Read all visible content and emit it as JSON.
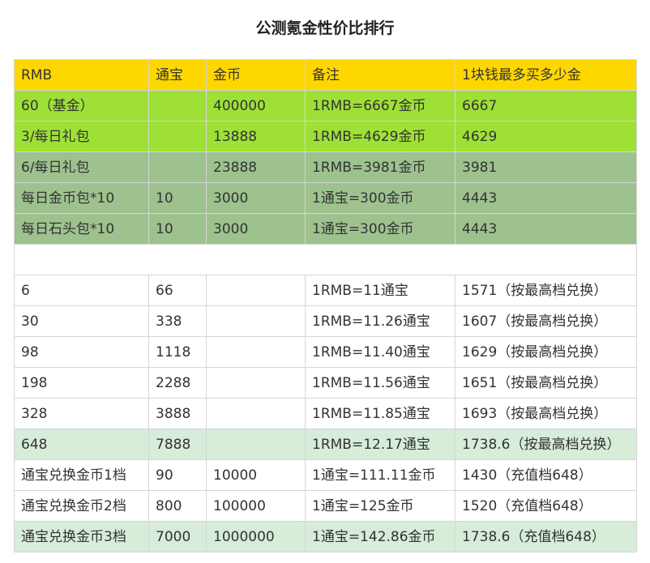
{
  "title": "公测氪金性价比排行",
  "table": {
    "headers": [
      "RMB",
      "通宝",
      "金币",
      "备注",
      "1块钱最多买多少金"
    ],
    "section1": [
      {
        "style": "bright",
        "cells": [
          "60（基金）",
          "",
          "400000",
          "1RMB=6667金币",
          "6667"
        ]
      },
      {
        "style": "bright",
        "cells": [
          "3/每日礼包",
          "",
          "13888",
          "1RMB=4629金币",
          "4629"
        ]
      },
      {
        "style": "sage",
        "cells": [
          "6/每日礼包",
          "",
          "23888",
          "1RMB=3981金币",
          "3981"
        ]
      },
      {
        "style": "sage",
        "cells": [
          "每日金币包*10",
          "10",
          "3000",
          "1通宝=300金币",
          "4443"
        ]
      },
      {
        "style": "sage",
        "cells": [
          "每日石头包*10",
          "10",
          "3000",
          "1通宝=300金币",
          "4443"
        ]
      }
    ],
    "section2": [
      {
        "style": "plain",
        "cells": [
          "6",
          "66",
          "",
          "1RMB=11通宝",
          "1571（按最高档兑换）"
        ]
      },
      {
        "style": "plain",
        "cells": [
          "30",
          "338",
          "",
          "1RMB=11.26通宝",
          "1607（按最高档兑换）"
        ]
      },
      {
        "style": "plain",
        "cells": [
          "98",
          "1118",
          "",
          "1RMB=11.40通宝",
          "1629（按最高档兑换）"
        ]
      },
      {
        "style": "plain",
        "cells": [
          "198",
          "2288",
          "",
          "1RMB=11.56通宝",
          "1651（按最高档兑换）"
        ]
      },
      {
        "style": "plain",
        "cells": [
          "328",
          "3888",
          "",
          "1RMB=11.85通宝",
          "1693（按最高档兑换）"
        ]
      },
      {
        "style": "pale",
        "cells": [
          "648",
          "7888",
          "",
          "1RMB=12.17通宝",
          "1738.6（按最高档兑换）"
        ]
      },
      {
        "style": "plain",
        "cells": [
          "通宝兑换金币1档",
          "90",
          "10000",
          "1通宝=111.11金币",
          "1430（充值档648）"
        ]
      },
      {
        "style": "plain",
        "cells": [
          "通宝兑换金币2档",
          "800",
          "100000",
          "1通宝=125金币",
          "1520（充值档648）"
        ]
      },
      {
        "style": "pale",
        "cells": [
          "通宝兑换金币3档",
          "7000",
          "1000000",
          "1通宝=142.86金币",
          "1738.6（充值档648）"
        ]
      }
    ]
  },
  "colors": {
    "header": "#ffd700",
    "bright_green": "#9ee036",
    "sage_green": "#9dc28e",
    "pale_green": "#d7ecd9"
  }
}
